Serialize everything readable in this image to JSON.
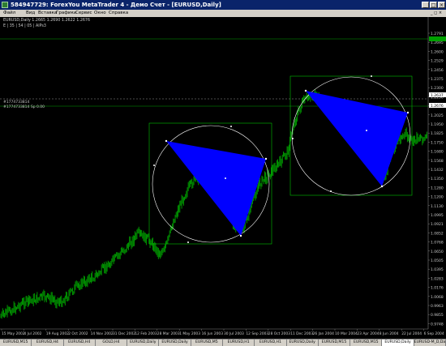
{
  "window": {
    "title": "584947729: ForexYou MetaTrader 4 - Демо Счет - [EURUSD,Daily]"
  },
  "menu": [
    "Файл",
    "Вид",
    "Вставка",
    "Графики",
    "Сервис",
    "Окно",
    "Справка"
  ],
  "chart": {
    "symbol_info": "EURUSD,Daily  1.2665  1.2690  1.2622  1.2676",
    "indicator_info": "E | 35 | 54 | 05 | AlPs3",
    "line_label_1": "#1774733814",
    "line_label_2": "#1774733814 Sp 0.00",
    "colors": {
      "background": "#000000",
      "candles": "#00a000",
      "triangle": "#0000ff",
      "grid_box": "#00c000",
      "circle": "#ffffff",
      "hline": "#00a000"
    },
    "price_axis": [
      "1.2791",
      "1.2695",
      "1.2600",
      "1.2529",
      "1.2456",
      "1.2375",
      "1.2300",
      "1.2236",
      "1.2095",
      "1.2025",
      "1.1950",
      "1.1825",
      "1.1750",
      "1.1680",
      "1.1568",
      "1.1432",
      "1.1350",
      "1.1280",
      "1.1200",
      "1.1130",
      "1.0995",
      "1.0921",
      "1.0852",
      "1.0768",
      "1.0650",
      "1.0505",
      "1.0395",
      "1.0283",
      "1.0176",
      "1.0068",
      "0.9963",
      "0.9855",
      "0.9748"
    ],
    "price_highlight_1": "1.2637",
    "price_highlight_2": "1.2676",
    "date_axis": [
      "15 May 2002",
      "4 Jul 2002",
      "19 Aug 2002",
      "2 Oct 2002",
      "14 Nov 2002",
      "31 Dec 2002",
      "12 Feb 2003",
      "28 Mar 2003",
      "1 May 2003",
      "16 Jun 2003",
      "30 Jul 2003",
      "12 Sep 2003",
      "28 Oct 2003",
      "11 Dec 2003",
      "26 Jan 2004",
      "10 Mar 2004",
      "23 Apr 2004",
      "8 Jun 2004",
      "22 Jul 2004",
      "6 Sep 2004"
    ]
  },
  "tabs": [
    "EURUSD,M15",
    "EURUSD,H4",
    "EURUSD,H4",
    "GOLD,H4",
    "EURUSD,Daily",
    "EURUSD,Daily",
    "EURUSD,M5",
    "EURUSD,H1",
    "EURUSD,H1",
    "EURUSD,Daily",
    "EURUSD,M15",
    "EURUSD,M15",
    "EURUSD,Daily",
    "EURUSD-M_D,Daily (offline)"
  ],
  "active_tab_index": 12
}
